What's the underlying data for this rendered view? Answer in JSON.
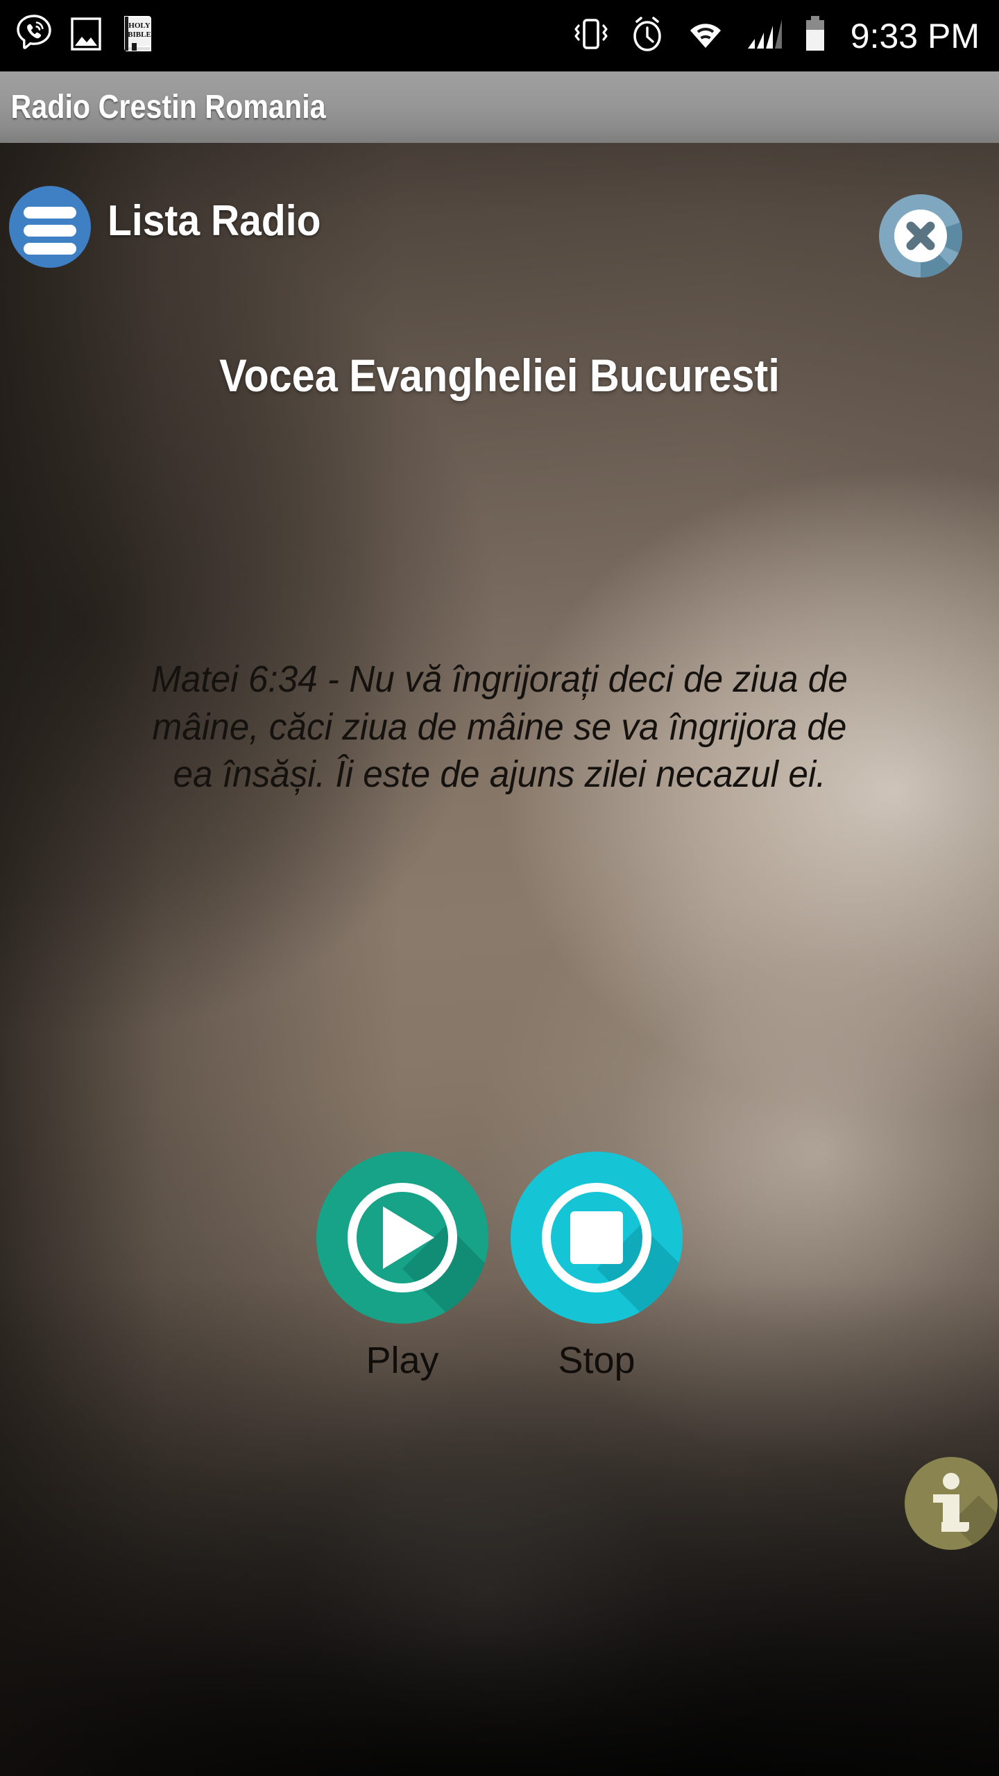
{
  "status_bar": {
    "notification_icons": [
      "viber-icon",
      "gallery-image-icon",
      "holy-bible-icon"
    ],
    "bible_icon_line1": "HOLY",
    "bible_icon_line2": "BIBLE",
    "system_icons": [
      "vibrate-icon",
      "alarm-clock-icon",
      "wifi-icon",
      "cellular-signal-icon",
      "battery-icon"
    ],
    "clock": "9:33 PM",
    "background_color": "#000000"
  },
  "app_bar": {
    "title": "Radio Crestin Romania"
  },
  "nav": {
    "menu_label": "menu",
    "title": "Lista Radio",
    "close_label": "close",
    "menu_color": "#3f7fc4",
    "close_color": "#7fa8c0"
  },
  "station": {
    "name": "Vocea Evangheliei Bucuresti"
  },
  "verse": {
    "text": "Matei 6:34 - Nu vă îngrijorați deci de ziua de mâine, căci ziua de mâine se va îngrijora de ea însăși. Îi este de ajuns zilei necazul ei."
  },
  "controls": [
    {
      "id": "play",
      "label": "Play",
      "color": "#17a388",
      "icon": "play-triangle-icon"
    },
    {
      "id": "stop",
      "label": "Stop",
      "color": "#15c5d6",
      "icon": "stop-square-icon"
    }
  ],
  "info": {
    "label": "i",
    "color": "#8a8550"
  }
}
